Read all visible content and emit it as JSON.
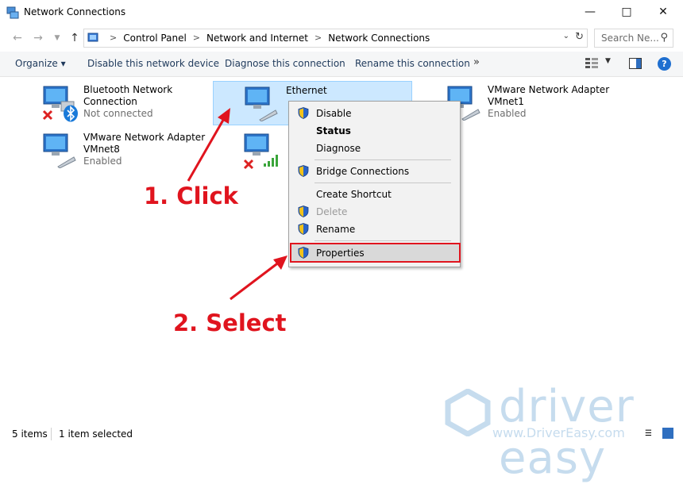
{
  "window": {
    "title": "Network Connections"
  },
  "address": {
    "crumbs": [
      "Control Panel",
      "Network and Internet",
      "Network Connections"
    ],
    "search_placeholder": "Search Ne..."
  },
  "toolbar": {
    "organize": "Organize",
    "disable": "Disable this network device",
    "diagnose": "Diagnose this connection",
    "rename": "Rename this connection",
    "more": "»"
  },
  "items": [
    {
      "name": "Bluetooth Network",
      "name2": "Connection",
      "status": "Not connected"
    },
    {
      "name": "VMware Network Adapter",
      "name2": "VMnet8",
      "status": "Enabled"
    },
    {
      "name": "Ethernet"
    },
    {
      "name": "VMware Network Adapter",
      "name2": "VMnet1",
      "status": "Enabled"
    }
  ],
  "context_menu": {
    "disable": "Disable",
    "status": "Status",
    "diagnose": "Diagnose",
    "bridge": "Bridge Connections",
    "shortcut": "Create Shortcut",
    "delete": "Delete",
    "rename": "Rename",
    "properties": "Properties"
  },
  "annotations": {
    "step1": "1. Click",
    "step2": "2. Select"
  },
  "statusbar": {
    "count": "5 items",
    "selected": "1 item selected"
  },
  "watermark": {
    "brand": "driver easy",
    "url": "www.DriverEasy.com"
  },
  "colors": {
    "annotation": "#e0141e",
    "selection": "#cce8ff",
    "help": "#1f6fd0"
  }
}
